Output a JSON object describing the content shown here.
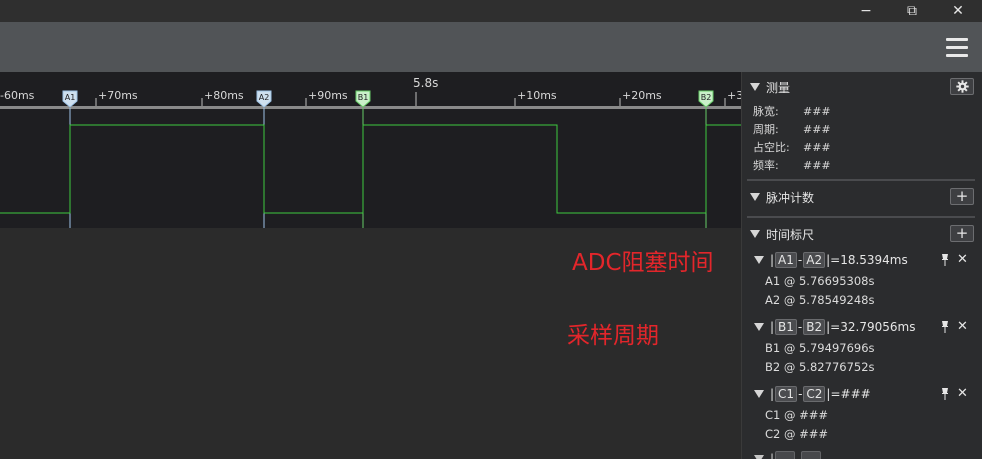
{
  "window": {
    "minimize_glyph": "−",
    "maximize_glyph": "⧉",
    "close_glyph": "✕"
  },
  "ruler": {
    "ticks": [
      "-60ms",
      "+70ms",
      "+80ms",
      "+90ms",
      "5.8s",
      "+10ms",
      "+20ms",
      "+3"
    ],
    "markers": [
      "A1",
      "A2",
      "B1",
      "B2"
    ]
  },
  "annotations": {
    "adc_block_time": "ADC阻塞时间",
    "sample_period": "采样周期"
  },
  "panel": {
    "measure": {
      "title": "测量",
      "rows": [
        {
          "label": "脉宽:",
          "value": "###"
        },
        {
          "label": "周期:",
          "value": "###"
        },
        {
          "label": "占空比:",
          "value": "###"
        },
        {
          "label": "频率:",
          "value": "###"
        }
      ]
    },
    "pulse_count": {
      "title": "脉冲计数",
      "add": "+"
    },
    "time_ruler": {
      "title": "时间标尺",
      "add": "+",
      "cursors": [
        {
          "a": "A1",
          "b": "A2",
          "delta": "18.5394ms",
          "line1": "A1 @ 5.76695308s",
          "line2": "A2 @ 5.78549248s"
        },
        {
          "a": "B1",
          "b": "B2",
          "delta": "32.79056ms",
          "line1": "B1 @ 5.79497696s",
          "line2": "B2 @ 5.82776752s"
        },
        {
          "a": "C1",
          "b": "C2",
          "delta": "###",
          "line1": "C1 @ ###",
          "line2": "C2 @ ###"
        }
      ]
    }
  },
  "colors": {
    "signal": "#3ec93e",
    "cursor_a": "#9ec3e6",
    "cursor_b": "#66cc66",
    "annotation": "#e3262b"
  }
}
